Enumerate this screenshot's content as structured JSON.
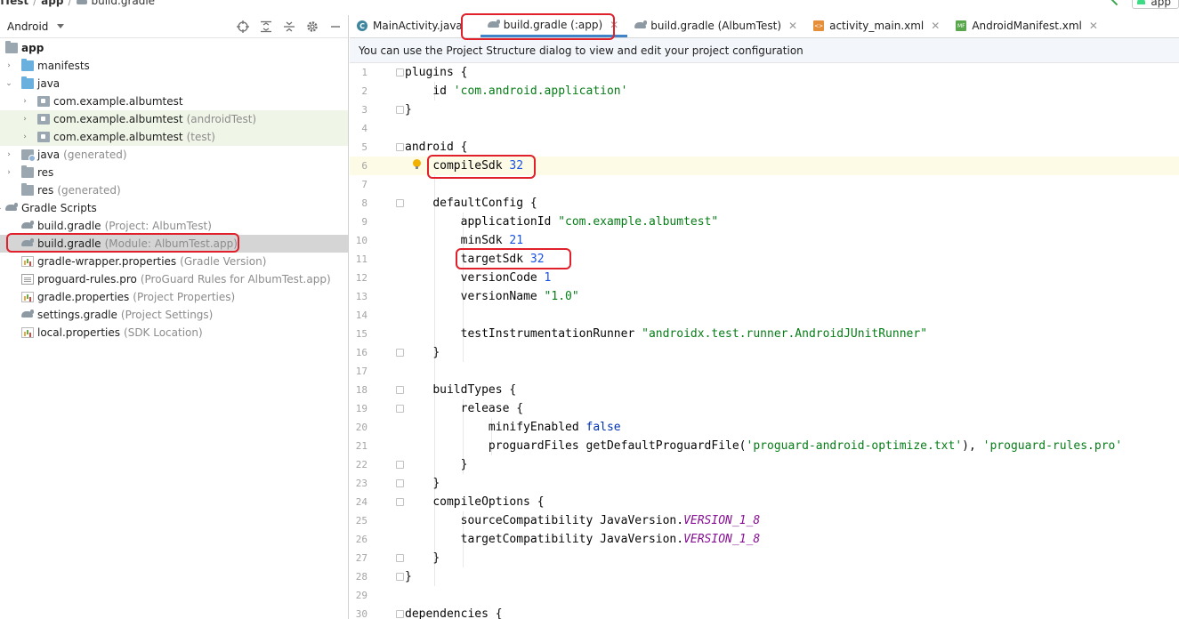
{
  "breadcrumb": {
    "project": "mTest",
    "module": "app",
    "file": "build.gradle",
    "run_config": "app"
  },
  "project_panel": {
    "view_mode": "Android",
    "tree": [
      {
        "label": "app",
        "bold": true,
        "hint": ""
      },
      {
        "label": "manifests",
        "hint": ""
      },
      {
        "label": "java",
        "hint": ""
      },
      {
        "label": "com.example.albumtest",
        "hint": ""
      },
      {
        "label": "com.example.albumtest",
        "hint": "(androidTest)"
      },
      {
        "label": "com.example.albumtest",
        "hint": "(test)"
      },
      {
        "label": "java",
        "hint": "(generated)"
      },
      {
        "label": "res",
        "hint": ""
      },
      {
        "label": "res",
        "hint": "(generated)"
      },
      {
        "label": "Gradle Scripts",
        "hint": ""
      },
      {
        "label": "build.gradle",
        "hint": "(Project: AlbumTest)"
      },
      {
        "label": "build.gradle",
        "hint": "(Module: AlbumTest.app)"
      },
      {
        "label": "gradle-wrapper.properties",
        "hint": "(Gradle Version)"
      },
      {
        "label": "proguard-rules.pro",
        "hint": "(ProGuard Rules for AlbumTest.app)"
      },
      {
        "label": "gradle.properties",
        "hint": "(Project Properties)"
      },
      {
        "label": "settings.gradle",
        "hint": "(Project Settings)"
      },
      {
        "label": "local.properties",
        "hint": "(SDK Location)"
      }
    ]
  },
  "tabs": [
    {
      "label": "MainActivity.java",
      "icon": "class-icon"
    },
    {
      "label": "build.gradle (:app)",
      "icon": "gradle-icon",
      "active": true
    },
    {
      "label": "build.gradle (AlbumTest)",
      "icon": "gradle-icon"
    },
    {
      "label": "activity_main.xml",
      "icon": "xml-icon"
    },
    {
      "label": "AndroidManifest.xml",
      "icon": "manifest-icon"
    }
  ],
  "notice": "You can use the Project Structure dialog to view and edit your project configuration",
  "code": {
    "line_numbers": [
      "1",
      "2",
      "3",
      "4",
      "5",
      "6",
      "7",
      "8",
      "9",
      "10",
      "11",
      "12",
      "13",
      "14",
      "15",
      "16",
      "17",
      "18",
      "19",
      "20",
      "21",
      "22",
      "23",
      "24",
      "25",
      "26",
      "27",
      "28",
      "29",
      "30"
    ],
    "l1": "plugins {",
    "l2a": "id ",
    "l2b": "'com.android.application'",
    "l3": "}",
    "l5": "android {",
    "l6a": "compileSdk ",
    "l6b": "32",
    "l8": "defaultConfig {",
    "l9a": "applicationId ",
    "l9b": "\"com.example.albumtest\"",
    "l10a": "minSdk ",
    "l10b": "21",
    "l11a": "targetSdk ",
    "l11b": "32",
    "l12a": "versionCode ",
    "l12b": "1",
    "l13a": "versionName ",
    "l13b": "\"1.0\"",
    "l15a": "testInstrumentationRunner ",
    "l15b": "\"androidx.test.runner.AndroidJUnitRunner\"",
    "l16": "}",
    "l18": "buildTypes {",
    "l19": "release {",
    "l20a": "minifyEnabled ",
    "l20b": "false",
    "l21a": "proguardFiles getDefaultProguardFile(",
    "l21b": "'proguard-android-optimize.txt'",
    "l21c": "), ",
    "l21d": "'proguard-rules.pro'",
    "l22": "}",
    "l23": "}",
    "l24": "compileOptions {",
    "l25a": "sourceCompatibility JavaVersion.",
    "l25b": "VERSION_1_8",
    "l26a": "targetCompatibility JavaVersion.",
    "l26b": "VERSION_1_8",
    "l27": "}",
    "l28": "}",
    "l30": "dependencies {"
  },
  "colors": {
    "highlight_box": "#e0202a",
    "string": "#067d17",
    "number": "#1750eb",
    "keyword": "#0033b3",
    "constant": "#871094",
    "active_tab_underline": "#4083c9"
  }
}
